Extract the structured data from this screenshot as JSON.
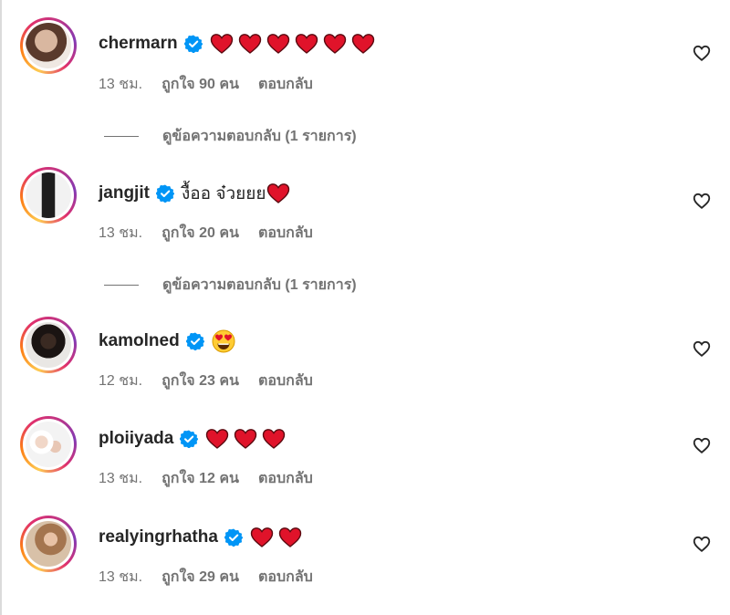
{
  "comments": [
    {
      "username": "chermarn",
      "verified": true,
      "text": "",
      "hearts": 6,
      "time": "13 ชม.",
      "likes": "ถูกใจ 90 คน",
      "reply_label": "ตอบกลับ",
      "view_replies": "ดูข้อความตอบกลับ (1 รายการ)"
    },
    {
      "username": "jangjit",
      "verified": true,
      "text": "งื้ออ จ๋วยยย",
      "hearts": 1,
      "time": "13 ชม.",
      "likes": "ถูกใจ 20 คน",
      "reply_label": "ตอบกลับ",
      "view_replies": "ดูข้อความตอบกลับ (1 รายการ)"
    },
    {
      "username": "kamolned",
      "verified": true,
      "text": "",
      "emoji": "heart-eyes-emoji",
      "time": "12 ชม.",
      "likes": "ถูกใจ 23 คน",
      "reply_label": "ตอบกลับ"
    },
    {
      "username": "ploiiyada",
      "verified": true,
      "text": "",
      "hearts": 3,
      "time": "13 ชม.",
      "likes": "ถูกใจ 12 คน",
      "reply_label": "ตอบกลับ"
    },
    {
      "username": "realyingrhatha",
      "verified": true,
      "text": "",
      "hearts": 2,
      "time": "13 ชม.",
      "likes": "ถูกใจ 29 คน",
      "reply_label": "ตอบกลับ"
    }
  ],
  "icons": {
    "verified": "verified-badge-icon",
    "like": "heart-outline-icon",
    "heart_emoji": "red-heart-emoji"
  },
  "colors": {
    "verified_blue": "#0095f6",
    "heart_red": "#e0132a",
    "meta_gray": "#737373",
    "username": "#262626"
  }
}
